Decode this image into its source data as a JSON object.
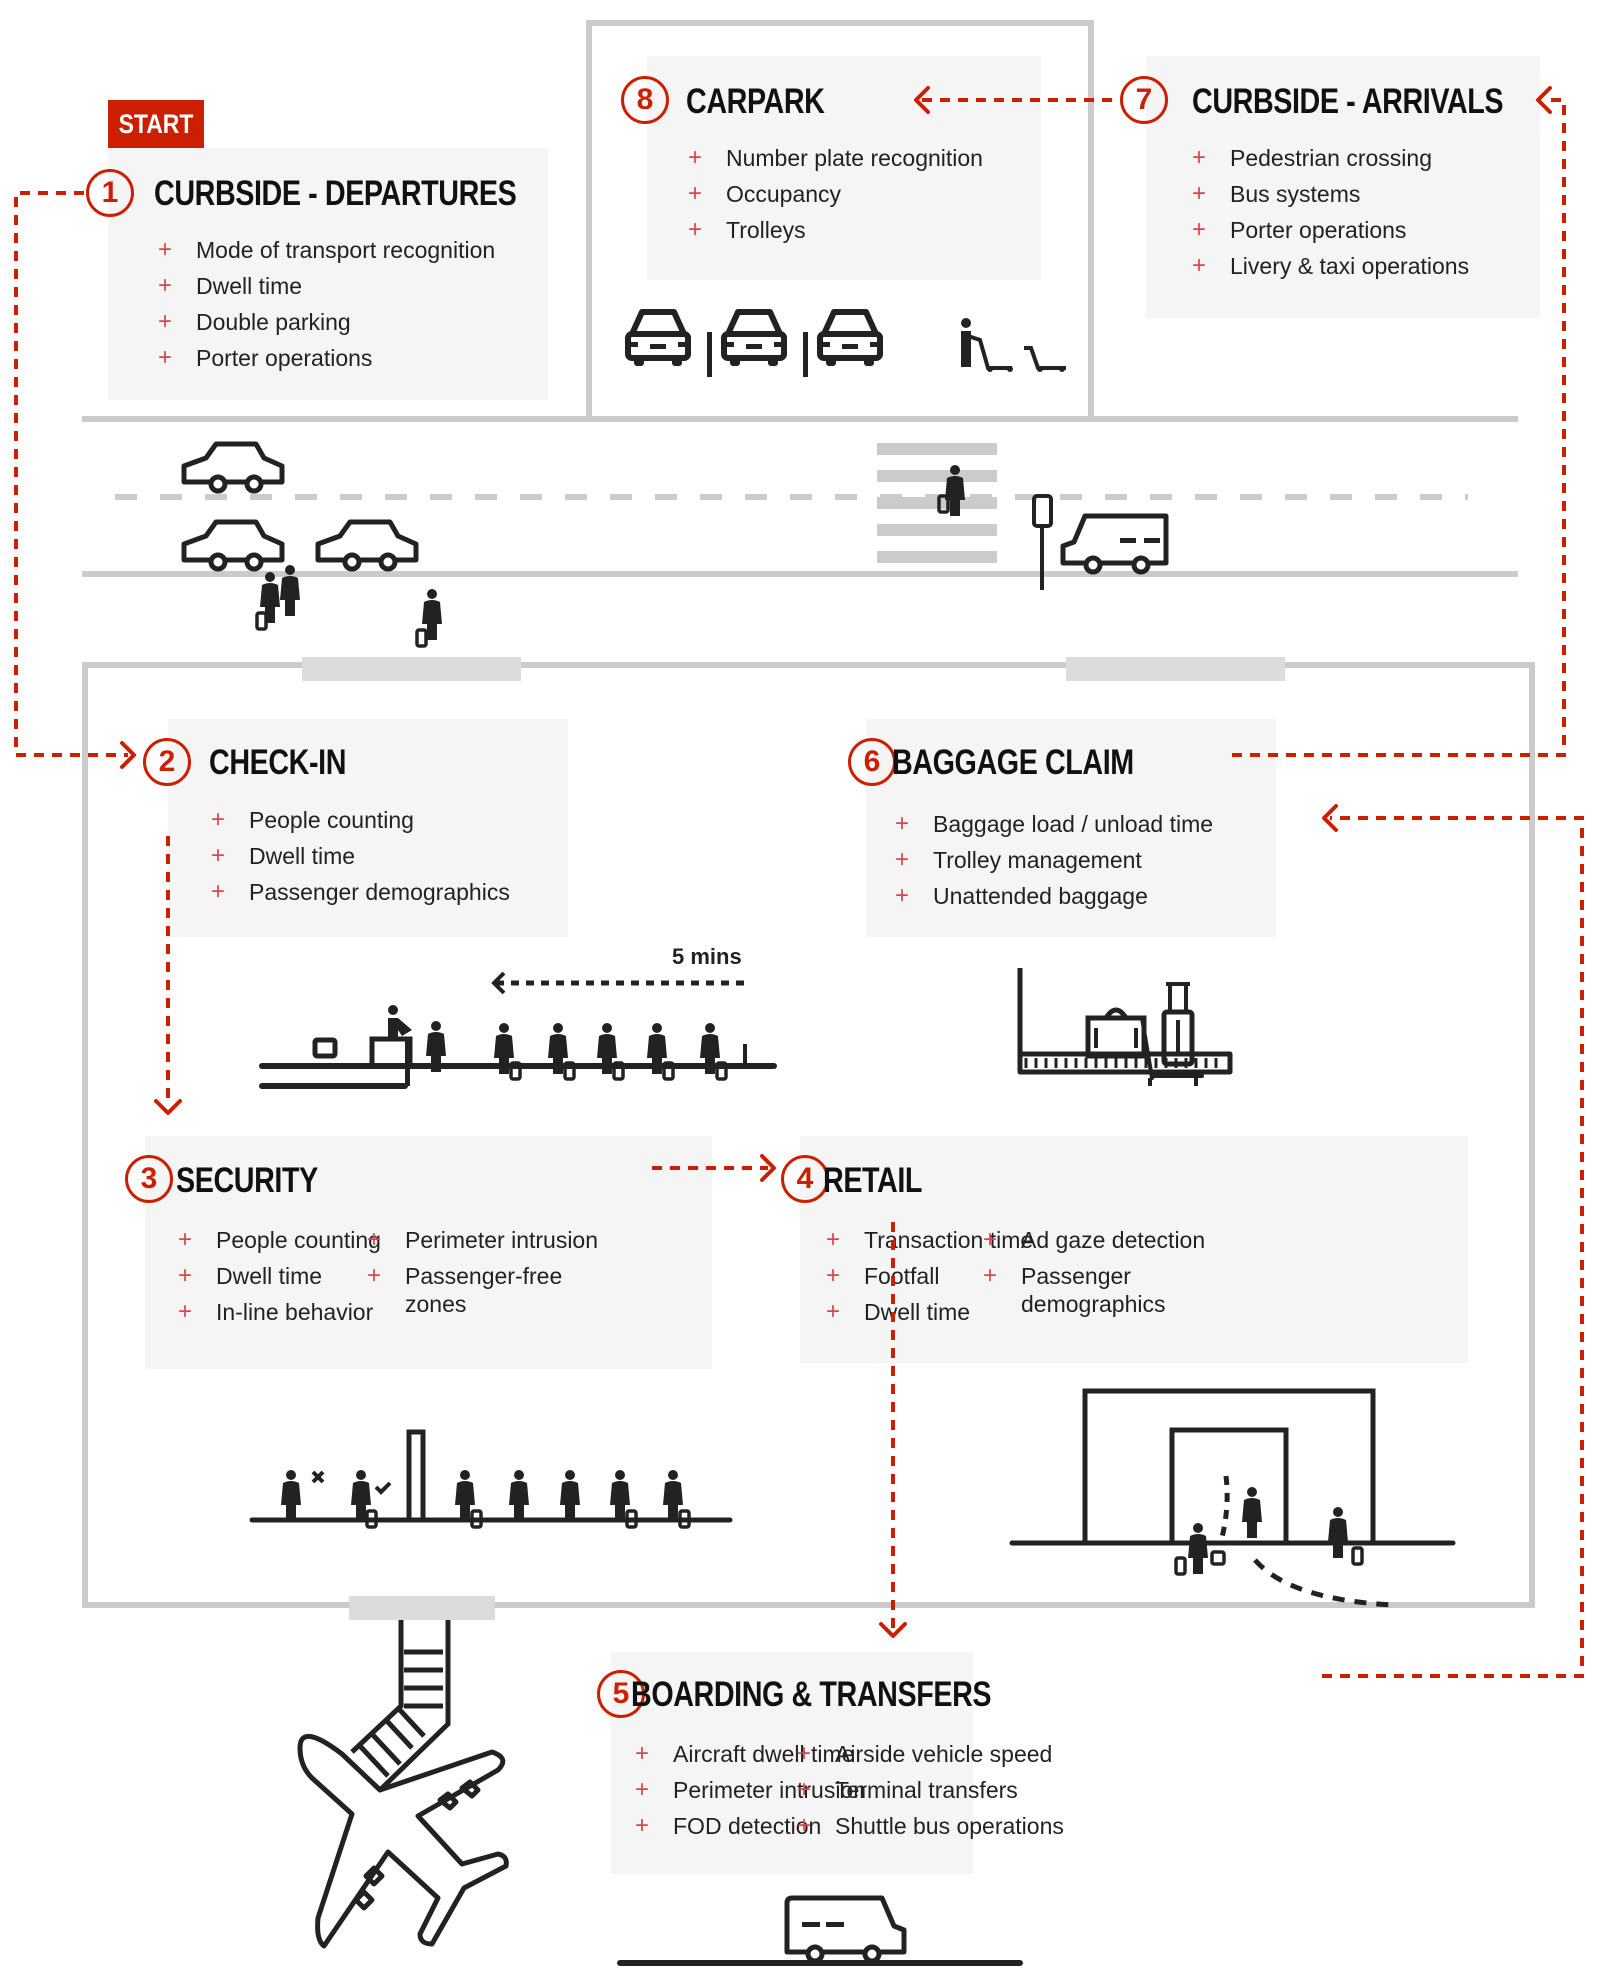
{
  "start_label": "START",
  "stages": {
    "s1": {
      "number": "1",
      "title": "CURBSIDE - DEPARTURES",
      "items": [
        "Mode of transport recognition",
        "Dwell time",
        "Double parking",
        "Porter operations"
      ]
    },
    "s2": {
      "number": "2",
      "title": "CHECK-IN",
      "items": [
        "People counting",
        "Dwell time",
        "Passenger demographics"
      ]
    },
    "s3": {
      "number": "3",
      "title": "SECURITY",
      "items_col1": [
        "People counting",
        "Dwell time",
        "In-line behavior"
      ],
      "items_col2": [
        "Perimeter intrusion",
        "Passenger-free zones"
      ]
    },
    "s4": {
      "number": "4",
      "title": "RETAIL",
      "items_col1": [
        "Transaction time",
        "Footfall",
        "Dwell time"
      ],
      "items_col2": [
        "Ad gaze detection",
        "Passenger demographics"
      ]
    },
    "s5": {
      "number": "5",
      "title": "BOARDING & TRANSFERS",
      "items_col1": [
        "Aircraft dwell time",
        "Perimeter intrusion",
        "FOD detection"
      ],
      "items_col2": [
        "Airside vehicle speed",
        "Terminal transfers",
        "Shuttle bus operations"
      ]
    },
    "s6": {
      "number": "6",
      "title": "BAGGAGE CLAIM",
      "items": [
        "Baggage load / unload time",
        "Trolley management",
        "Unattended baggage"
      ]
    },
    "s7": {
      "number": "7",
      "title": "CURBSIDE - ARRIVALS",
      "items": [
        "Pedestrian crossing",
        "Bus systems",
        "Porter operations",
        "Livery & taxi operations"
      ]
    },
    "s8": {
      "number": "8",
      "title": "CARPARK",
      "items": [
        "Number plate recognition",
        "Occupancy",
        "Trolleys"
      ]
    }
  },
  "queue_time_label": "5 mins",
  "colors": {
    "accent": "#cc1f00",
    "plus": "#d9474a",
    "card": "#f5f5f5",
    "frame": "#cbcbcb",
    "icon": "#222222"
  }
}
